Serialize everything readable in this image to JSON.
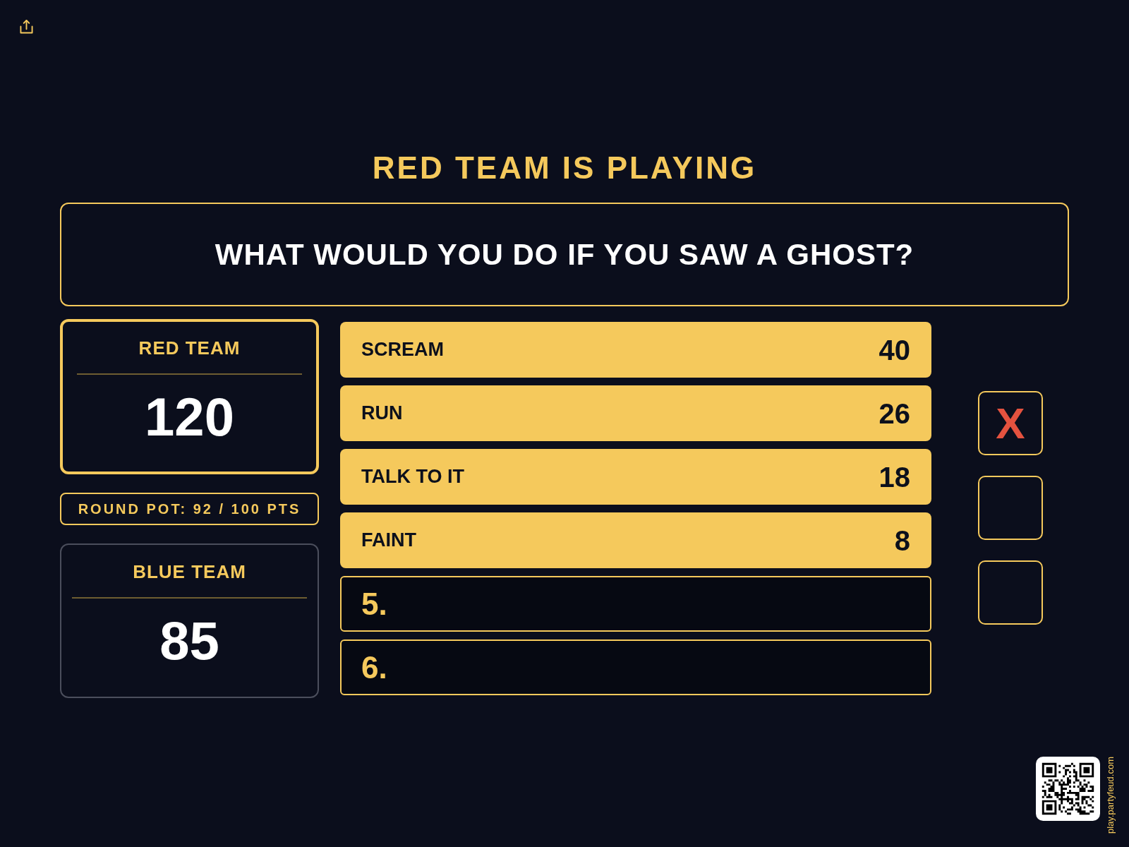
{
  "status": "RED TEAM IS PLAYING",
  "question": "WHAT WOULD YOU DO IF YOU SAW A GHOST?",
  "scoreboard": [
    {
      "kind": "team",
      "name": "RED TEAM",
      "score": "120",
      "active": true
    },
    {
      "kind": "pot",
      "text": "ROUND POT: 92 / 100 PTS"
    },
    {
      "kind": "team",
      "name": "BLUE TEAM",
      "score": "85",
      "active": false
    }
  ],
  "answers": [
    {
      "revealed": true,
      "answer": "SCREAM",
      "points": "40"
    },
    {
      "revealed": true,
      "answer": "RUN",
      "points": "26"
    },
    {
      "revealed": true,
      "answer": "TALK TO IT",
      "points": "18"
    },
    {
      "revealed": true,
      "answer": "FAINT",
      "points": "8"
    },
    {
      "revealed": false,
      "number": "5."
    },
    {
      "revealed": false,
      "number": "6."
    }
  ],
  "strikes": {
    "mark": "X",
    "boxes": [
      {
        "struck": true
      },
      {
        "struck": false
      },
      {
        "struck": false
      }
    ]
  },
  "footer": {
    "url": "play.partyfeud.com"
  }
}
